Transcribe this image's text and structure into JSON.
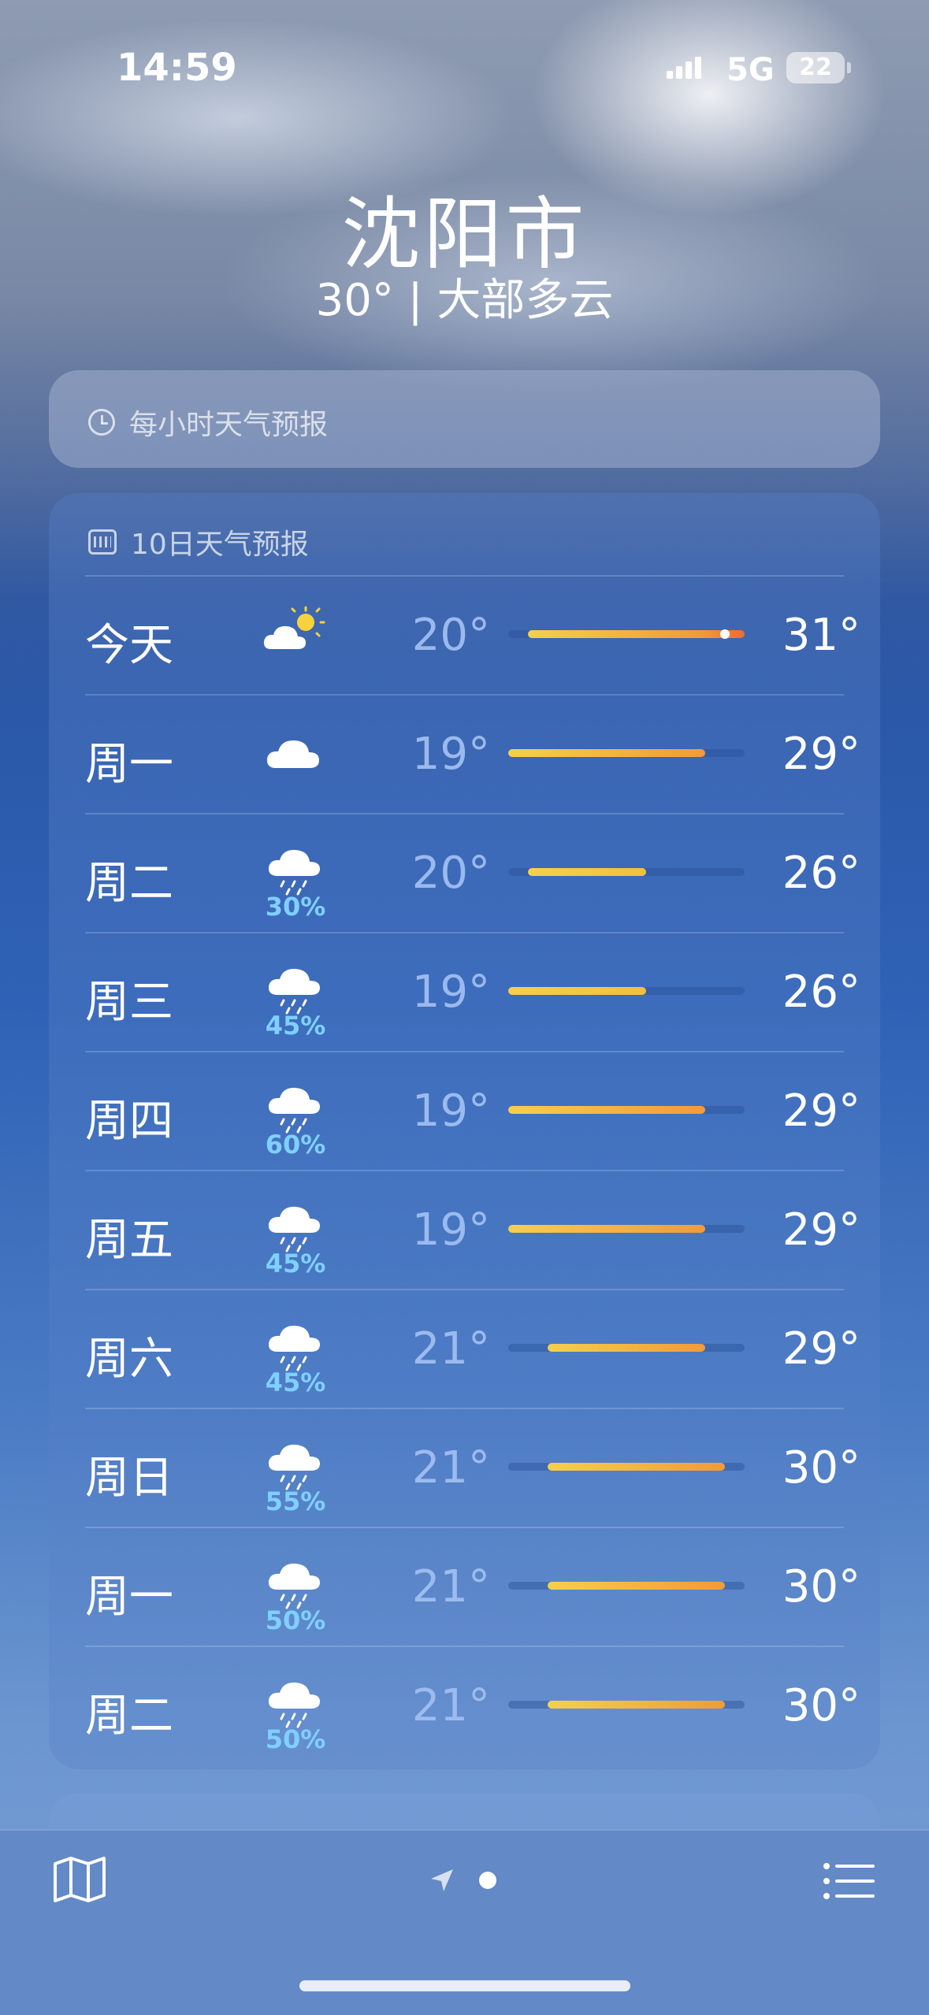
{
  "status": {
    "time": "14:59",
    "network": "5G",
    "battery": "22"
  },
  "location": {
    "city": "沈阳市",
    "summary": "30° | 大部多云"
  },
  "hourly": {
    "title": "每小时天气预报",
    "icon": "clock-icon"
  },
  "daily": {
    "title": "10日天气预报",
    "icon": "calendar-icon",
    "range": {
      "min": 19,
      "max": 31
    },
    "days": [
      {
        "day": "今天",
        "icon": "partly-sunny-icon",
        "precip": "",
        "low": "20°",
        "high": "31°",
        "current": 30
      },
      {
        "day": "周一",
        "icon": "cloud-icon",
        "precip": "",
        "low": "19°",
        "high": "29°"
      },
      {
        "day": "周二",
        "icon": "rain-icon",
        "precip": "30%",
        "low": "20°",
        "high": "26°"
      },
      {
        "day": "周三",
        "icon": "rain-icon",
        "precip": "45%",
        "low": "19°",
        "high": "26°"
      },
      {
        "day": "周四",
        "icon": "rain-icon",
        "precip": "60%",
        "low": "19°",
        "high": "29°"
      },
      {
        "day": "周五",
        "icon": "rain-icon",
        "precip": "45%",
        "low": "19°",
        "high": "29°"
      },
      {
        "day": "周六",
        "icon": "rain-icon",
        "precip": "45%",
        "low": "21°",
        "high": "29°"
      },
      {
        "day": "周日",
        "icon": "rain-icon",
        "precip": "55%",
        "low": "21°",
        "high": "30°"
      },
      {
        "day": "周一",
        "icon": "rain-icon",
        "precip": "50%",
        "low": "21°",
        "high": "30°"
      },
      {
        "day": "周二",
        "icon": "rain-icon",
        "precip": "50%",
        "low": "21°",
        "high": "30°"
      }
    ]
  },
  "bottom": {
    "left_icon": "map-icon",
    "center_icons": [
      "location-arrow-icon",
      "page-dot"
    ],
    "right_icon": "list-icon"
  },
  "colors": {
    "bar_cool": "#f4d04c",
    "bar_warm": "#f29a3a",
    "bar_hot": "#f26a2e",
    "precip": "#7fd0ff"
  }
}
